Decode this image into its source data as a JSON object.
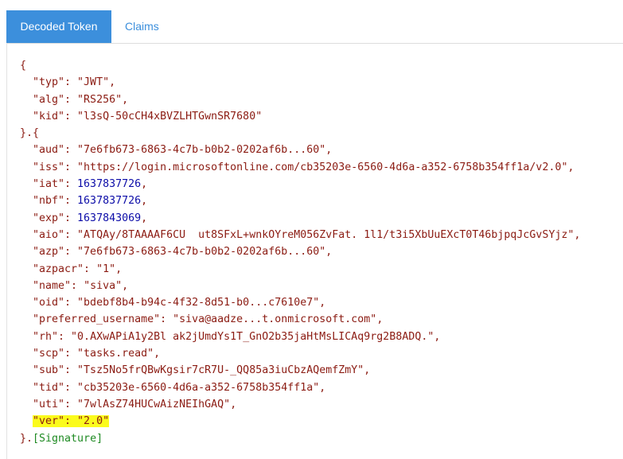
{
  "tabs": [
    {
      "label": "Decoded Token",
      "active": true
    },
    {
      "label": "Claims",
      "active": false
    }
  ],
  "colors": {
    "accent": "#3c8fdc",
    "highlight": "#fbfb1c",
    "string": "#8b1b12",
    "number": "#0c0ca8",
    "signature": "#1e8a22"
  },
  "header": [
    {
      "key": "\"typ\"",
      "value": "\"JWT\"",
      "sep": ","
    },
    {
      "key": "\"alg\"",
      "value": "\"RS256\"",
      "sep": ","
    },
    {
      "key": "\"kid\"",
      "value": "\"l3sQ-50cCH4xBVZLHTGwnSR7680\"",
      "sep": ""
    }
  ],
  "payload": [
    {
      "key": "\"aud\"",
      "value": "\"7e6fb673-6863-4c7b-b0b2-0202af6b...60\"",
      "sep": ",",
      "type": "str"
    },
    {
      "key": "\"iss\"",
      "value": "\"https://login.microsoftonline.com/cb35203e-6560-4d6a-a352-6758b354ff1a/v2.0\"",
      "sep": ",",
      "type": "str"
    },
    {
      "key": "\"iat\"",
      "value": "1637837726",
      "sep": ",",
      "type": "num"
    },
    {
      "key": "\"nbf\"",
      "value": "1637837726",
      "sep": ",",
      "type": "num"
    },
    {
      "key": "\"exp\"",
      "value": "1637843069",
      "sep": ",",
      "type": "num"
    },
    {
      "key": "\"aio\"",
      "value": "\"ATQAy/8TAAAAF6CU  ut8SFxL+wnkOYreM056ZvFat. 1l1/t3i5XbUuEXcT0T46bjpqJcGvSYjz\"",
      "sep": ",",
      "type": "str"
    },
    {
      "key": "\"azp\"",
      "value": "\"7e6fb673-6863-4c7b-b0b2-0202af6b...60\"",
      "sep": ",",
      "type": "str"
    },
    {
      "key": "\"azpacr\"",
      "value": "\"1\"",
      "sep": ",",
      "type": "str"
    },
    {
      "key": "\"name\"",
      "value": "\"siva\"",
      "sep": ",",
      "type": "str"
    },
    {
      "key": "\"oid\"",
      "value": "\"bdebf8b4-b94c-4f32-8d51-b0...c7610e7\"",
      "sep": ",",
      "type": "str"
    },
    {
      "key": "\"preferred_username\"",
      "value": "\"siva@aadze...t.onmicrosoft.com\"",
      "sep": ",",
      "type": "str"
    },
    {
      "key": "\"rh\"",
      "value": "\"0.AXwAPiA1y2Bl ak2jUmdYs1T_GnO2b35jaHtMsLICAq9rg2B8ADQ.\"",
      "sep": ",",
      "type": "str"
    },
    {
      "key": "\"scp\"",
      "value": "\"tasks.read\"",
      "sep": ",",
      "type": "str"
    },
    {
      "key": "\"sub\"",
      "value": "\"Tsz5No5frQBwKgsir7cR7U-_QQ85a3iuCbzAQemfZmY\"",
      "sep": ",",
      "type": "str"
    },
    {
      "key": "\"tid\"",
      "value": "\"cb35203e-6560-4d6a-a352-6758b354ff1a\"",
      "sep": ",",
      "type": "str"
    },
    {
      "key": "\"uti\"",
      "value": "\"7wlAsZ74HUCwAizNEIhGAQ\"",
      "sep": ",",
      "type": "str"
    },
    {
      "key": "\"ver\"",
      "value": "\"2.0\"",
      "sep": "",
      "type": "str",
      "highlighted": true
    }
  ],
  "braces": {
    "open": "{",
    "separator": "}.{",
    "close_prefix": "}.",
    "signature": "[Signature]"
  }
}
